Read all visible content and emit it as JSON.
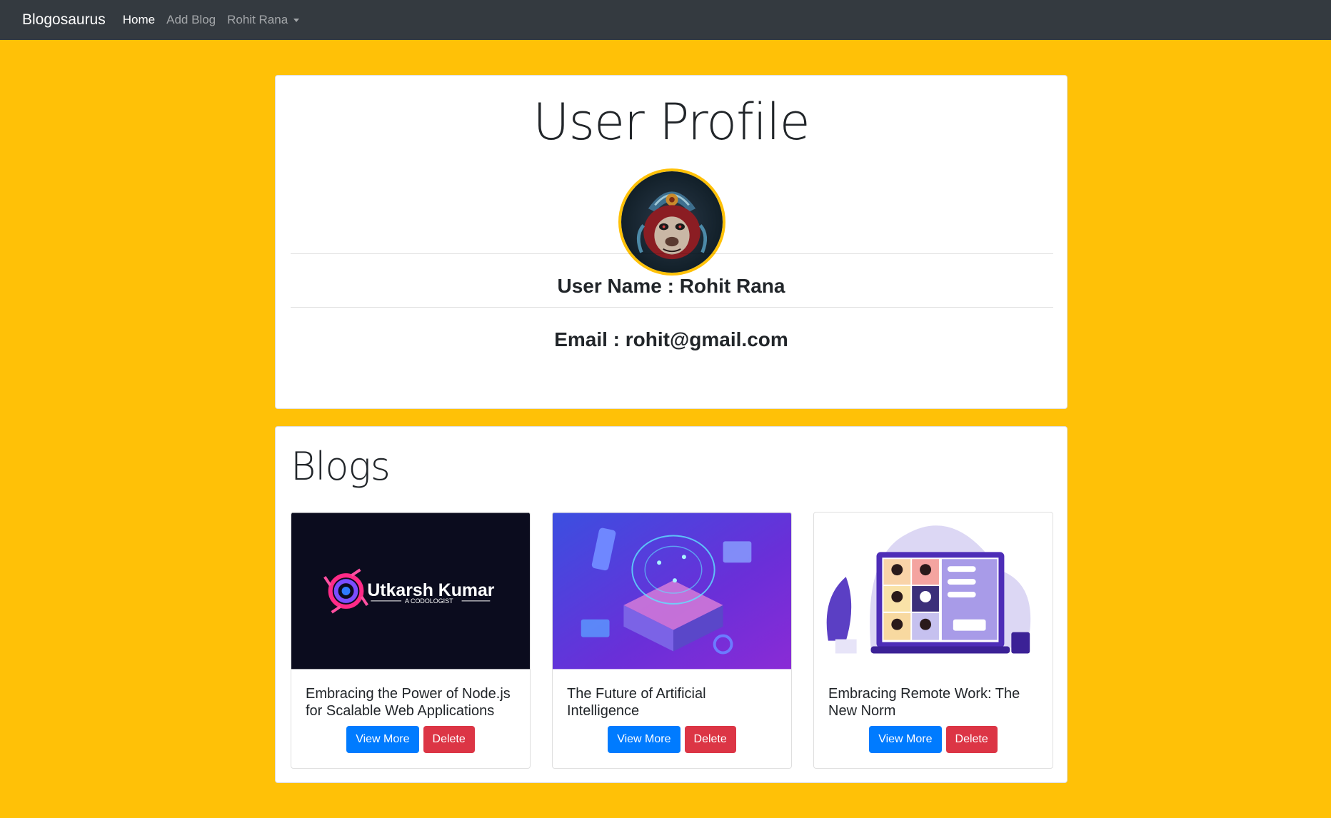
{
  "navbar": {
    "brand": "Blogosaurus",
    "links": [
      "Home",
      "Add Blog"
    ],
    "user_menu": "Rohit Rana"
  },
  "profile": {
    "title": "User Profile",
    "user_name": "User Name : Rohit Rana",
    "email": "Email : rohit@gmail.com"
  },
  "blogs": {
    "title": "Blogs",
    "items": [
      {
        "title": "Embracing the Power of Node.js for Scalable Web Applications",
        "image_text": "Utkarsh Kumar",
        "image_subtext": "A CODOLOGIST"
      },
      {
        "title": "The Future of Artificial Intelligence"
      },
      {
        "title": "Embracing Remote Work: The New Norm"
      }
    ],
    "view_more_label": "View More",
    "delete_label": "Delete"
  },
  "colors": {
    "background": "#ffc107",
    "navbar": "#343a40",
    "primary": "#007bff",
    "danger": "#dc3545"
  }
}
